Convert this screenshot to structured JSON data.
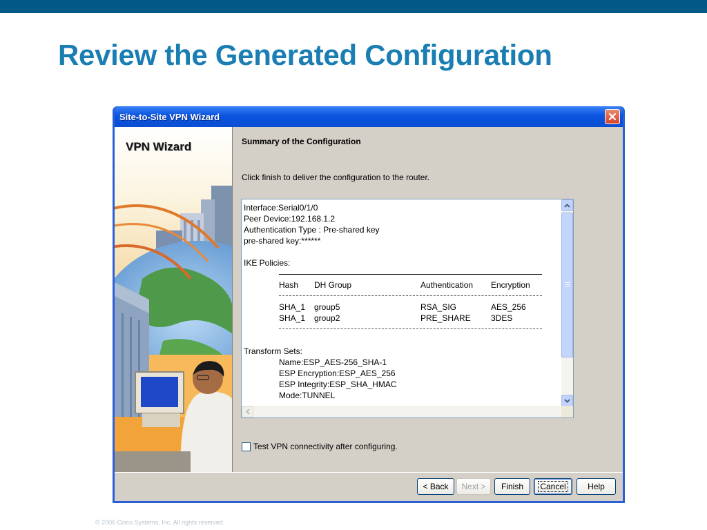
{
  "slide": {
    "title": "Review the Generated Configuration",
    "footer": "© 2006 Cisco Systems, Inc. All rights reserved."
  },
  "window": {
    "title": "Site-to-Site VPN Wizard",
    "sidebar_title": "VPN Wizard"
  },
  "content": {
    "summary_title": "Summary of the Configuration",
    "instructions": "Click finish to deliver the configuration to the router.",
    "config": {
      "interface": "Interface:Serial0/1/0",
      "peer": "Peer Device:192.168.1.2",
      "auth_type": "Authentication Type : Pre-shared key",
      "psk": "pre-shared key:******",
      "ike_title": "IKE Policies:",
      "ike_headers": [
        "Hash",
        "DH Group",
        "Authentication",
        "Encryption"
      ],
      "ike_rows": [
        [
          "SHA_1",
          "group5",
          "RSA_SIG",
          "AES_256"
        ],
        [
          "SHA_1",
          "group2",
          "PRE_SHARE",
          "3DES"
        ]
      ],
      "ts_title": "Transform Sets:",
      "ts_name": "Name:ESP_AES-256_SHA-1",
      "ts_encryption": "ESP Encryption:ESP_AES_256",
      "ts_integrity": "ESP Integrity:ESP_SHA_HMAC",
      "ts_mode": "Mode:TUNNEL"
    },
    "checkbox_label": "Test VPN connectivity after configuring.",
    "checkbox_checked": false
  },
  "buttons": {
    "back": "< Back",
    "next": "Next >",
    "finish": "Finish",
    "cancel": "Cancel",
    "help": "Help"
  },
  "colors": {
    "slide_title": "#1a7eb3",
    "top_bar": "#005a85",
    "titlebar": "#0a55df"
  }
}
